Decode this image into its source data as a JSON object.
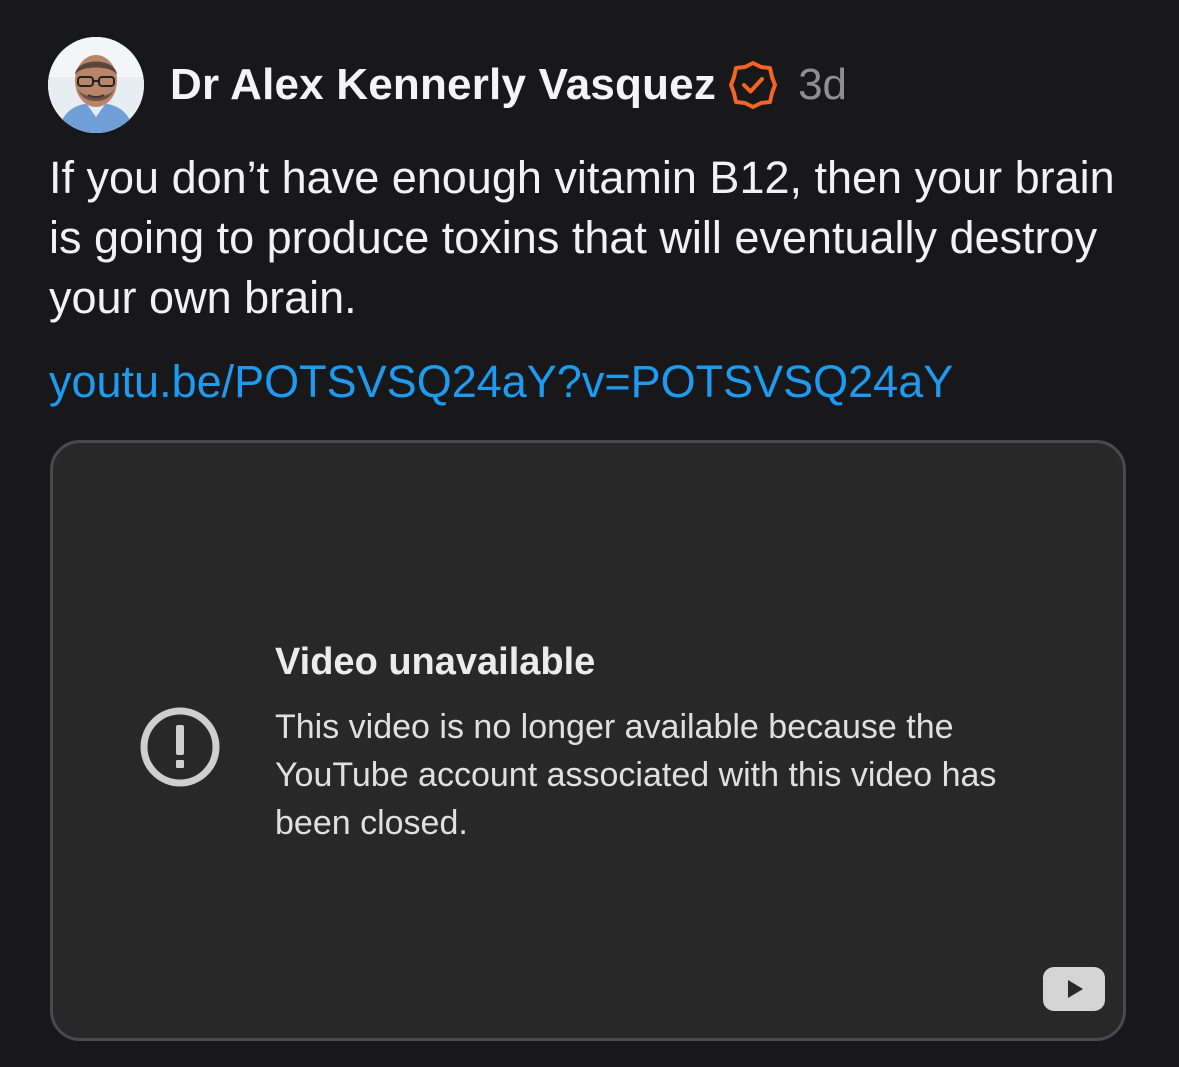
{
  "post": {
    "author": "Dr Alex Kennerly Vasquez",
    "timestamp": "3d",
    "body": "If you don’t have enough vitamin B12, then your brain is going to produce toxins that will eventually destroy your own brain.",
    "link": "youtu.be/POTSVSQ24aY?v=POTSVSQ24aY",
    "icons": {
      "avatar": "author-avatar",
      "verified": "verified-badge-icon"
    },
    "colors": {
      "background": "#18181b",
      "link": "#1d9bf0",
      "verified_badge": "#f26522"
    }
  },
  "embed": {
    "title": "Video unavailable",
    "message": "This video is no longer available because the YouTube account associated with this video has been closed.",
    "icons": {
      "warning": "exclamation-circle-icon",
      "logo": "youtube-logo-icon"
    },
    "colors": {
      "background": "#282828",
      "border": "#4a4a4c"
    }
  }
}
